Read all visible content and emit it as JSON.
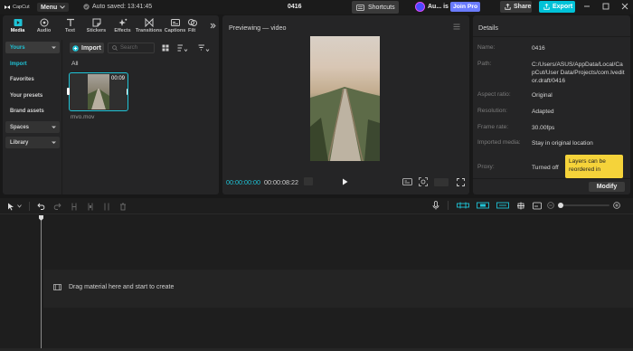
{
  "titlebar": {
    "app_name": "CapCut",
    "menu_label": "Menu",
    "autosave_text": "Auto saved: 13:41:45",
    "project_name": "0416",
    "shortcuts_label": "Shortcuts",
    "user_name": "Au... is",
    "join_pro_label": "Join Pro",
    "share_label": "Share",
    "export_label": "Export"
  },
  "toolbar": {
    "tools": [
      {
        "label": "Media"
      },
      {
        "label": "Audio"
      },
      {
        "label": "Text"
      },
      {
        "label": "Stickers"
      },
      {
        "label": "Effects"
      },
      {
        "label": "Transitions"
      },
      {
        "label": "Captions"
      },
      {
        "label": "Filt"
      }
    ]
  },
  "sidebar": {
    "yours_label": "Yours",
    "items": [
      "Import",
      "Favorites",
      "Your presets",
      "Brand assets"
    ],
    "spaces_label": "Spaces",
    "library_label": "Library"
  },
  "media": {
    "import_label": "Import",
    "search_placeholder": "Search",
    "all_label": "All",
    "clip_duration": "00:09",
    "clip_name": "mvo.mov"
  },
  "preview": {
    "title": "Previewing — video",
    "current_time": "00:00:00:00",
    "total_time": "00:00:08:22"
  },
  "details": {
    "title": "Details",
    "rows": [
      {
        "key": "Name:",
        "value": "0416"
      },
      {
        "key": "Path:",
        "value": "C:/Users/ASUS/AppData/Local/CapCut/User Data/Projects/com.lveditor.draft/0416"
      },
      {
        "key": "Aspect ratio:",
        "value": "Original"
      },
      {
        "key": "Resolution:",
        "value": "Adapted"
      },
      {
        "key": "Frame rate:",
        "value": "30.00fps"
      },
      {
        "key": "Imported media:",
        "value": "Stay in original location"
      },
      {
        "key": "Proxy:",
        "value": "Turned off"
      }
    ],
    "tooltip_text": "Layers can be reordered in",
    "modify_label": "Modify"
  },
  "timeline": {
    "drop_hint": "Drag material here and start to create"
  },
  "colors": {
    "accent": "#1fc3d6",
    "join_pro": "#6a7bff",
    "export": "#00c2d8",
    "tooltip": "#f5d33a"
  }
}
